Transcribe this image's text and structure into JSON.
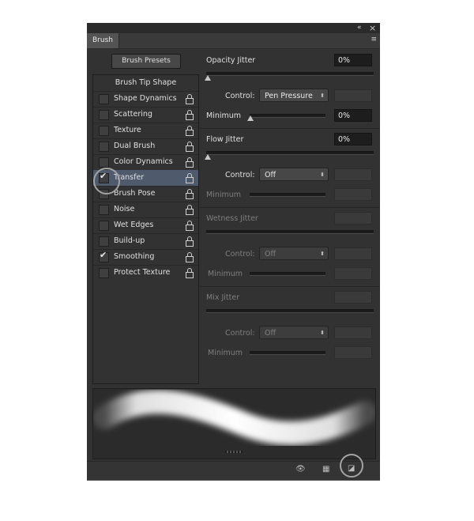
{
  "window": {
    "collapse_icon": "«",
    "close_icon": "×"
  },
  "tab": {
    "label": "Brush",
    "menu_icon": "≡"
  },
  "brush_presets_button": "Brush Presets",
  "list": {
    "header": "Brush Tip Shape",
    "items": [
      {
        "label": "Shape Dynamics",
        "checked": false
      },
      {
        "label": "Scattering",
        "checked": false
      },
      {
        "label": "Texture",
        "checked": false
      },
      {
        "label": "Dual Brush",
        "checked": false
      },
      {
        "label": "Color Dynamics",
        "checked": false
      },
      {
        "label": "Transfer",
        "checked": true,
        "selected": true
      },
      {
        "label": "Brush Pose",
        "checked": false
      },
      {
        "label": "Noise",
        "checked": false
      },
      {
        "label": "Wet Edges",
        "checked": false
      },
      {
        "label": "Build-up",
        "checked": false
      },
      {
        "label": "Smoothing",
        "checked": true
      },
      {
        "label": "Protect Texture",
        "checked": false
      }
    ],
    "check_glyph": "✔"
  },
  "opacity": {
    "label": "Opacity Jitter",
    "value": "0%",
    "control_label": "Control:",
    "control_value": "Pen Pressure",
    "minimum_label": "Minimum",
    "minimum_value": "0%"
  },
  "flow": {
    "label": "Flow Jitter",
    "value": "0%",
    "control_label": "Control:",
    "control_value": "Off",
    "minimum_label": "Minimum"
  },
  "wetness": {
    "label": "Wetness Jitter",
    "control_label": "Control:",
    "control_value": "Off",
    "minimum_label": "Minimum"
  },
  "mix": {
    "label": "Mix Jitter",
    "control_label": "Control:",
    "control_value": "Off",
    "minimum_label": "Minimum"
  },
  "select_arrow": "⬍",
  "footer_icons": [
    "eye-brush-icon",
    "grid-panel-icon",
    "new-preset-icon"
  ]
}
